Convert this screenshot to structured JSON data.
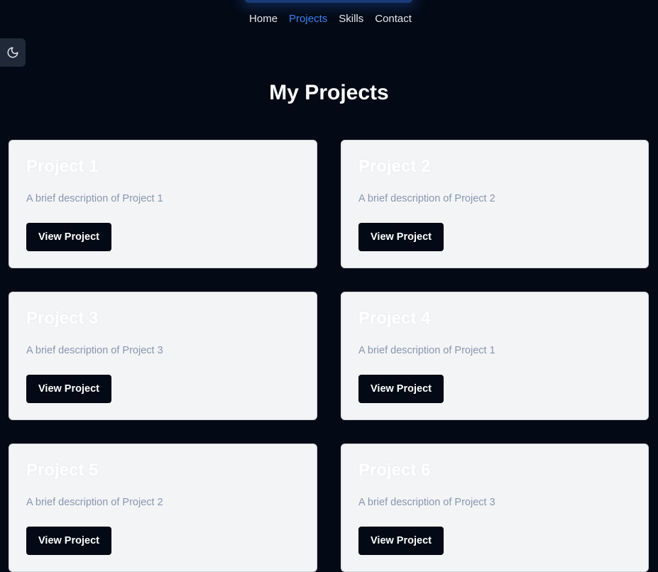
{
  "nav": {
    "items": [
      {
        "label": "Home",
        "active": false
      },
      {
        "label": "Projects",
        "active": true
      },
      {
        "label": "Skills",
        "active": false
      },
      {
        "label": "Contact",
        "active": false
      }
    ]
  },
  "theme_toggle": {
    "icon": "moon-icon"
  },
  "page": {
    "title": "My Projects"
  },
  "projects": [
    {
      "title": "Project 1",
      "description": "A brief description of Project 1",
      "button": "View Project"
    },
    {
      "title": "Project 2",
      "description": "A brief description of Project 2",
      "button": "View Project"
    },
    {
      "title": "Project 3",
      "description": "A brief description of Project 3",
      "button": "View Project"
    },
    {
      "title": "Project 4",
      "description": "A brief description of Project 1",
      "button": "View Project"
    },
    {
      "title": "Project 5",
      "description": "A brief description of Project 2",
      "button": "View Project"
    },
    {
      "title": "Project 6",
      "description": "A brief description of Project 3",
      "button": "View Project"
    }
  ],
  "colors": {
    "background": "#030a15",
    "accent": "#3b82f6",
    "card": "#f3f4f6",
    "description": "#8696b0"
  }
}
